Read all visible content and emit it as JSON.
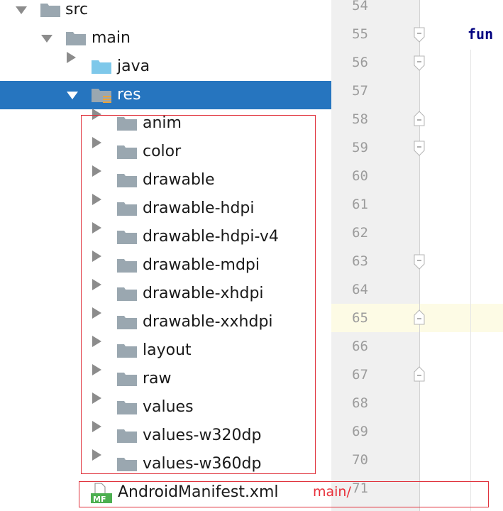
{
  "tree": {
    "items": [
      {
        "label": "src",
        "expanded": true
      },
      {
        "label": "main",
        "expanded": true
      },
      {
        "label": "java",
        "expanded": false
      },
      {
        "label": "res",
        "expanded": true,
        "selected": true
      },
      {
        "label": "anim",
        "expanded": false
      },
      {
        "label": "color",
        "expanded": false
      },
      {
        "label": "drawable",
        "expanded": false
      },
      {
        "label": "drawable-hdpi",
        "expanded": false
      },
      {
        "label": "drawable-hdpi-v4",
        "expanded": false
      },
      {
        "label": "drawable-mdpi",
        "expanded": false
      },
      {
        "label": "drawable-xhdpi",
        "expanded": false
      },
      {
        "label": "drawable-xxhdpi",
        "expanded": false
      },
      {
        "label": "layout",
        "expanded": false
      },
      {
        "label": "raw",
        "expanded": false
      },
      {
        "label": "values",
        "expanded": false
      },
      {
        "label": "values-w320dp",
        "expanded": false
      },
      {
        "label": "values-w360dp",
        "expanded": false
      }
    ],
    "manifest": {
      "label": "AndroidManifest.xml",
      "badge": "MF"
    }
  },
  "annotation": {
    "text": "main/"
  },
  "editor": {
    "line_numbers": [
      "54",
      "55",
      "56",
      "57",
      "58",
      "59",
      "60",
      "61",
      "62",
      "63",
      "64",
      "65",
      "66",
      "67",
      "68",
      "69",
      "70",
      "71"
    ],
    "current_line": "65",
    "keyword": "fun"
  },
  "colors": {
    "selection": "#2675bf",
    "folder": "#9aa7b0",
    "java_folder": "#7ec8ea",
    "annotation": "#e8303a",
    "keyword": "#000080",
    "gutter": "#f0f0f0",
    "current_line": "#fdfbe5"
  },
  "icons": [
    "expand-arrow-icon",
    "collapse-arrow-icon",
    "folder-icon",
    "source-folder-icon",
    "resource-folder-icon",
    "manifest-file-icon",
    "fold-marker-icon"
  ]
}
